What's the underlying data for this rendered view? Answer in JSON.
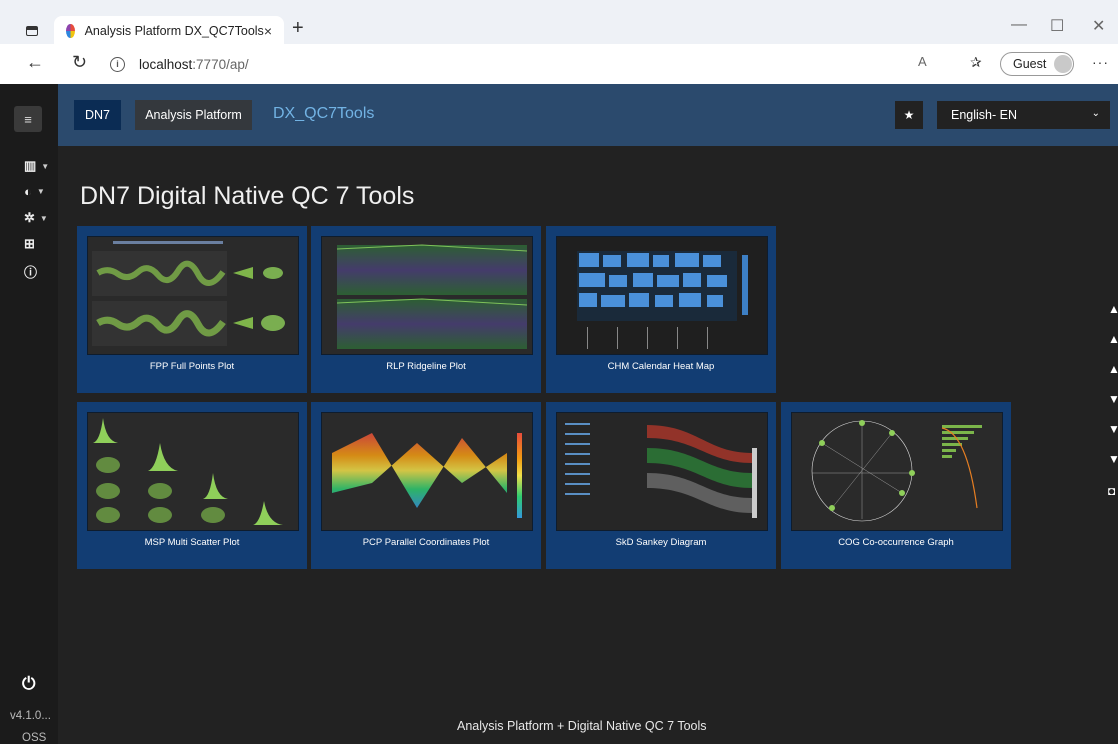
{
  "browser": {
    "tab_title": "Analysis Platform DX_QC7Tools",
    "tab_close": "×",
    "new_tab": "+",
    "url_host": "localhost",
    "url_path": ":7770/ap/",
    "profile_label": "Guest",
    "controls": {
      "minimize": "—",
      "maximize": "☐",
      "close": "✕"
    },
    "nav": {
      "back": "←",
      "reload": "↻"
    },
    "read_aloud": "A",
    "favorites_icon": "✰",
    "more": "···"
  },
  "sidebar": {
    "menu_icon": "≡",
    "items": [
      {
        "icon": "chart-bar-icon",
        "glyph": "▥",
        "caret": "▼"
      },
      {
        "icon": "brain-icon",
        "glyph": "◐",
        "caret": "▼"
      },
      {
        "icon": "gear-icon",
        "glyph": "✲",
        "caret": "▼"
      },
      {
        "icon": "table-icon",
        "glyph": "⊞",
        "caret": ""
      },
      {
        "icon": "info-icon",
        "glyph": "ⓘ",
        "caret": ""
      }
    ],
    "power_glyph": "⏻",
    "version": "v4.1.0...",
    "oss": "OSS"
  },
  "header": {
    "dn7": "DN7",
    "analysis_platform": "Analysis Platform",
    "app_title": "DX_QC7Tools",
    "star": "★",
    "language": "English- EN",
    "language_caret": "⌄"
  },
  "main": {
    "title": "DN7 Digital Native QC 7 Tools",
    "cards": [
      {
        "label": "FPP Full Points Plot",
        "thumb": "fpp"
      },
      {
        "label": "RLP Ridgeline Plot",
        "thumb": "rlp"
      },
      {
        "label": "CHM Calendar Heat Map",
        "thumb": "chm"
      },
      {
        "label": "MSP Multi Scatter Plot",
        "thumb": "msp"
      },
      {
        "label": "PCP Parallel Coordinates Plot",
        "thumb": "pcp"
      },
      {
        "label": "SkD Sankey Diagram",
        "thumb": "skd"
      },
      {
        "label": "COG Co-occurrence Graph",
        "thumb": "cog"
      }
    ]
  },
  "footer": {
    "text": "Analysis Platform + Digital Native QC 7 Tools"
  },
  "colors": {
    "background": "#222222",
    "header": "#2b4a6d",
    "card": "#123d73",
    "accent_title": "#72b3e4"
  }
}
